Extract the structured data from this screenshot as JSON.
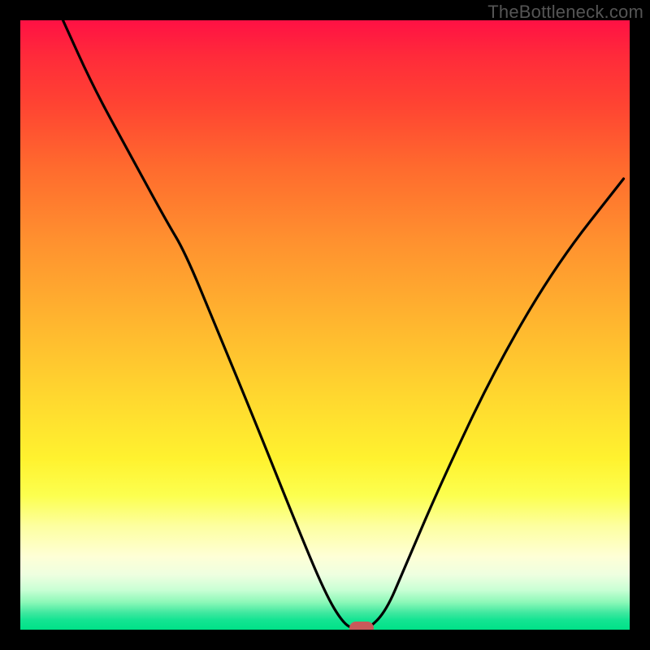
{
  "watermark": "TheBottleneck.com",
  "chart_data": {
    "type": "line",
    "title": "",
    "xlabel": "",
    "ylabel": "",
    "xlim": [
      0,
      100
    ],
    "ylim": [
      0,
      100
    ],
    "grid": false,
    "background": "vertical gradient red→orange→yellow→pale→green",
    "series": [
      {
        "name": "curve",
        "x": [
          7,
          12,
          18,
          24,
          27,
          32,
          39,
          45,
          50,
          53,
          55,
          57,
          60,
          63,
          69,
          78,
          88,
          99
        ],
        "values": [
          100,
          89,
          78,
          67,
          62,
          50,
          33,
          18,
          6,
          1,
          0,
          0,
          3,
          10,
          24,
          43,
          60,
          74
        ]
      }
    ],
    "marker": {
      "x": 56,
      "y": 0,
      "color": "#c85a5a"
    },
    "gradient_stops": [
      {
        "pos": 0,
        "color": "#ff1144"
      },
      {
        "pos": 24,
        "color": "#ff6a2e"
      },
      {
        "pos": 50,
        "color": "#ffb72f"
      },
      {
        "pos": 72,
        "color": "#fff22f"
      },
      {
        "pos": 88,
        "color": "#feffd6"
      },
      {
        "pos": 95,
        "color": "#8cf8b8"
      },
      {
        "pos": 100,
        "color": "#00e288"
      }
    ]
  }
}
